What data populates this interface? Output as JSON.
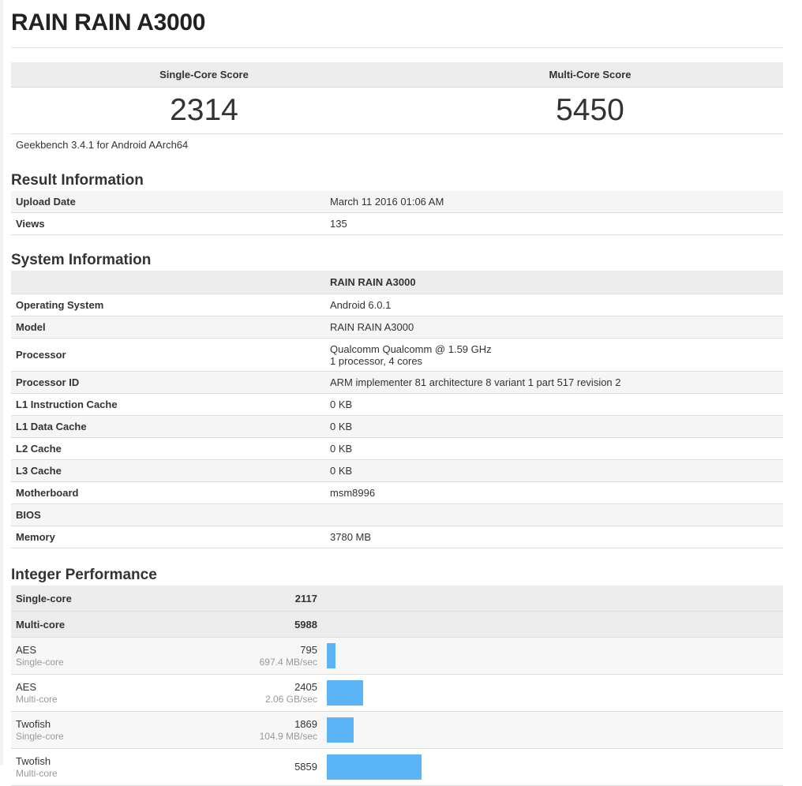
{
  "page_title": "RAIN RAIN A3000",
  "scores": {
    "single_label": "Single-Core Score",
    "multi_label": "Multi-Core Score",
    "single_value": "2314",
    "multi_value": "5450",
    "version": "Geekbench 3.4.1 for Android AArch64"
  },
  "result_info": {
    "heading": "Result Information",
    "rows": [
      {
        "key": "Upload Date",
        "value": "March 11 2016 01:06 AM"
      },
      {
        "key": "Views",
        "value": "135"
      }
    ]
  },
  "system_info": {
    "heading": "System Information",
    "device_header": "RAIN RAIN A3000",
    "rows": [
      {
        "key": "Operating System",
        "value": "Android 6.0.1"
      },
      {
        "key": "Model",
        "value": "RAIN RAIN A3000"
      },
      {
        "key": "Processor",
        "value": "Qualcomm Qualcomm @ 1.59 GHz",
        "value2": "1 processor, 4 cores"
      },
      {
        "key": "Processor ID",
        "value": "ARM implementer 81 architecture 8 variant 1 part 517 revision 2"
      },
      {
        "key": "L1 Instruction Cache",
        "value": "0 KB"
      },
      {
        "key": "L1 Data Cache",
        "value": "0 KB"
      },
      {
        "key": "L2 Cache",
        "value": "0 KB"
      },
      {
        "key": "L3 Cache",
        "value": "0 KB"
      },
      {
        "key": "Motherboard",
        "value": "msm8996"
      },
      {
        "key": "BIOS",
        "value": ""
      },
      {
        "key": "Memory",
        "value": "3780 MB"
      }
    ]
  },
  "integer_performance": {
    "heading": "Integer Performance",
    "single_label": "Single-core",
    "single_score": "2117",
    "multi_label": "Multi-core",
    "multi_score": "5988",
    "bar_color": "#5ab4f5",
    "benchmarks": [
      {
        "name": "AES",
        "mode": "Single-core",
        "score": "795",
        "rate": "697.4 MB/sec",
        "bar_level": 0.0188
      },
      {
        "name": "AES",
        "mode": "Multi-core",
        "score": "2405",
        "rate": "2.06 GB/sec",
        "bar_level": 0.0793
      },
      {
        "name": "Twofish",
        "mode": "Single-core",
        "score": "1869",
        "rate": "104.9 MB/sec",
        "bar_level": 0.0586
      },
      {
        "name": "Twofish",
        "mode": "Multi-core",
        "score": "5859",
        "rate": "",
        "bar_level": 0.2086
      }
    ]
  }
}
